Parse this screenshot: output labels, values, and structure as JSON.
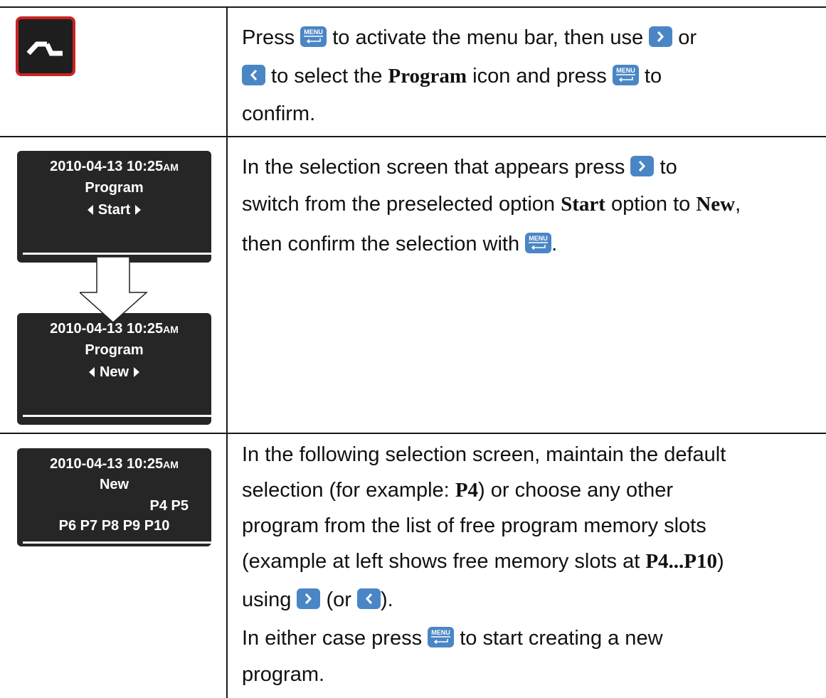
{
  "icons": {
    "program_icon": "program-icon",
    "menu_button": "menu-enter-button-icon",
    "right_button": "right-arrow-button-icon",
    "left_button": "left-arrow-button-icon",
    "down_arrow": "down-arrow-icon"
  },
  "colors": {
    "button_blue": "#4a86c6",
    "icon_red": "#cc2222",
    "lcd_background": "#262626"
  },
  "button_labels": {
    "menu": "MENU"
  },
  "row1": {
    "t1": "Press ",
    "t2": " to activate the menu bar, then use ",
    "t3": " or",
    "t4": " to select the ",
    "b1": "Program",
    "t5": " icon and press ",
    "t6": " to",
    "t7": "confirm."
  },
  "row2": {
    "screen_start": {
      "datetime": "2010-04-13  10:25",
      "ampm": "AM",
      "title": "Program",
      "option": "Start"
    },
    "screen_new": {
      "datetime": "2010-04-13  10:25",
      "ampm": "AM",
      "title": "Program",
      "option": "New"
    },
    "t1": "In the selection screen that appears press ",
    "t2": " to",
    "t3": "switch from the preselected option ",
    "b1": "Start",
    "t4": " option to ",
    "b2": "New",
    "t5": ",",
    "t6": "then confirm the selection with ",
    "t7": "."
  },
  "row3": {
    "screen": {
      "datetime": "2010-04-13  10:25",
      "ampm": "AM",
      "title": "New",
      "slots_line1": "P4  P5",
      "slots_line2": "P6  P7  P8  P9  P10"
    },
    "t1": "In the following selection screen, maintain the default",
    "t2": "selection (for example: ",
    "b1": "P4",
    "t3": ") or choose any other",
    "t4": "program from the list of free program memory slots",
    "t5": "(example at left shows free memory slots at ",
    "b2": "P4...P10",
    "t6": ")",
    "t7": "using ",
    "t8": " (or ",
    "t9": ").",
    "t10": "In either case press ",
    "t11": " to start creating a new",
    "t12": "program."
  }
}
